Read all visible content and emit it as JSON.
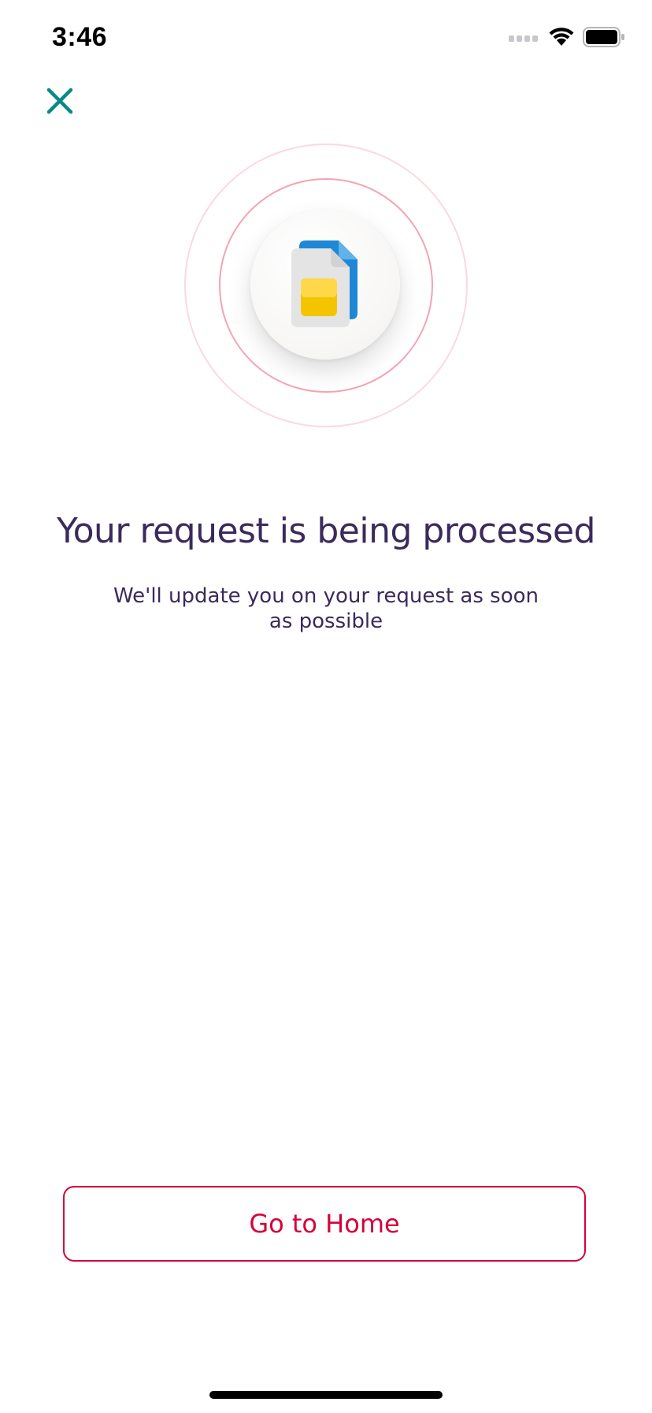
{
  "status_bar": {
    "time": "3:46",
    "icons": [
      "cellular-signal-icon",
      "wifi-icon",
      "battery-icon"
    ]
  },
  "header": {
    "close_icon": "close-icon",
    "accent_color": "#0a8a87"
  },
  "hero": {
    "icon": "sim-card-icon"
  },
  "content": {
    "title": "Your request is being processed",
    "subtitle": "We'll update you on your request as soon as possible"
  },
  "actions": {
    "home_button_label": "Go to Home",
    "brand_color": "#d6003a"
  },
  "colors": {
    "text_primary": "#3b2a5c",
    "ring_outer": "#fbd9df",
    "ring_inner": "#f3a3b5"
  }
}
